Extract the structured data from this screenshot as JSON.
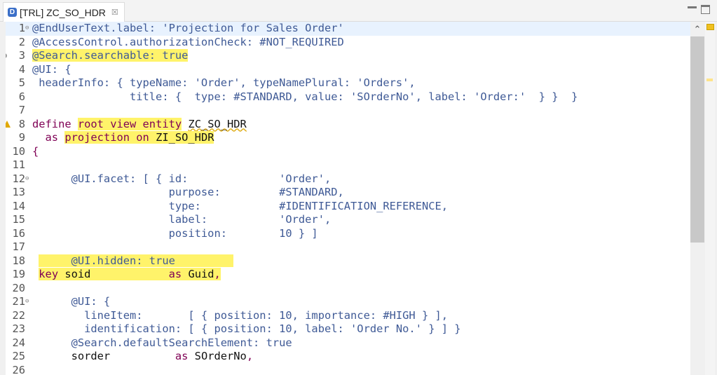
{
  "tab": {
    "icon_letter": "D",
    "title": "[TRL] ZC_SO_HDR",
    "close": "☒"
  },
  "scroll_up": "⌃",
  "colors": {
    "annotation": "#3f5a96",
    "keyword": "#7f0055",
    "highlight": "#fff36a",
    "current_line": "#e8f2fe"
  },
  "editor": {
    "lines": [
      {
        "n": "1",
        "fold": "⊖",
        "tokens": [
          {
            "c": "an",
            "t": "@EndUserText.label: 'Projection for Sales Order'"
          }
        ]
      },
      {
        "n": "2",
        "tokens": [
          {
            "c": "an",
            "t": "@AccessControl.authorizationCheck: #NOT_REQUIRED"
          }
        ]
      },
      {
        "n": "3",
        "marker": "dot",
        "tokens": [
          {
            "c": "an h",
            "t": "@Search.searchable: true"
          }
        ]
      },
      {
        "n": "4",
        "tokens": [
          {
            "c": "an",
            "t": "@UI: {"
          }
        ]
      },
      {
        "n": "5",
        "tokens": [
          {
            "c": "an",
            "t": " headerInfo: { typeName: 'Order', typeNamePlural: 'Orders',"
          }
        ]
      },
      {
        "n": "6",
        "tokens": [
          {
            "c": "an",
            "t": "               title: {  type: #STANDARD, value: 'SOrderNo', label: 'Order:'  } }  }"
          }
        ]
      },
      {
        "n": "7",
        "tokens": []
      },
      {
        "n": "8",
        "marker": "warn",
        "tokens": [
          {
            "c": "kw",
            "t": "define "
          },
          {
            "c": "kw h",
            "t": "root view entity"
          },
          {
            "c": "id",
            "t": " "
          },
          {
            "c": "id wavy",
            "t": "ZC_SO_HDR"
          }
        ]
      },
      {
        "n": "9",
        "tokens": [
          {
            "c": "kw",
            "t": "  as "
          },
          {
            "c": "kw h",
            "t": "projection on "
          },
          {
            "c": "id h",
            "t": "ZI_SO_HDR"
          }
        ]
      },
      {
        "n": "10",
        "tokens": [
          {
            "c": "kw",
            "t": "{"
          }
        ]
      },
      {
        "n": "11",
        "tokens": []
      },
      {
        "n": "12",
        "fold": "⊖",
        "tokens": [
          {
            "c": "an",
            "t": "      @UI.facet: [ { id:              'Order',"
          }
        ]
      },
      {
        "n": "13",
        "tokens": [
          {
            "c": "an",
            "t": "                     purpose:         #STANDARD,"
          }
        ]
      },
      {
        "n": "14",
        "tokens": [
          {
            "c": "an",
            "t": "                     type:            #IDENTIFICATION_REFERENCE,"
          }
        ]
      },
      {
        "n": "15",
        "tokens": [
          {
            "c": "an",
            "t": "                     label:           'Order',"
          }
        ]
      },
      {
        "n": "16",
        "tokens": [
          {
            "c": "an",
            "t": "                     position:        10 } ]"
          }
        ]
      },
      {
        "n": "17",
        "tokens": []
      },
      {
        "n": "18",
        "tokens": [
          {
            "c": "id",
            "t": " "
          },
          {
            "c": "an h",
            "t": "     @UI.hidden: true         "
          }
        ]
      },
      {
        "n": "19",
        "tokens": [
          {
            "c": "id",
            "t": " "
          },
          {
            "c": "kw h",
            "t": "key"
          },
          {
            "c": "id h",
            "t": " soid            "
          },
          {
            "c": "kw h",
            "t": "as"
          },
          {
            "c": "id h",
            "t": " Guid"
          },
          {
            "c": "kw h",
            "t": ","
          }
        ]
      },
      {
        "n": "20",
        "tokens": []
      },
      {
        "n": "21",
        "fold": "⊖",
        "tokens": [
          {
            "c": "an",
            "t": "      @UI: {"
          }
        ]
      },
      {
        "n": "22",
        "tokens": [
          {
            "c": "an",
            "t": "        lineItem:       [ { position: 10, importance: #HIGH } ],"
          }
        ]
      },
      {
        "n": "23",
        "tokens": [
          {
            "c": "an",
            "t": "        identification: [ { position: 10, label: 'Order No.' } ] }"
          }
        ]
      },
      {
        "n": "24",
        "tokens": [
          {
            "c": "an",
            "t": "      @Search.defaultSearchElement: true"
          }
        ]
      },
      {
        "n": "25",
        "tokens": [
          {
            "c": "id",
            "t": "      sorder          "
          },
          {
            "c": "kw",
            "t": "as"
          },
          {
            "c": "id",
            "t": " SOrderNo"
          },
          {
            "c": "kw",
            "t": ","
          }
        ]
      },
      {
        "n": "26",
        "tokens": []
      }
    ]
  }
}
